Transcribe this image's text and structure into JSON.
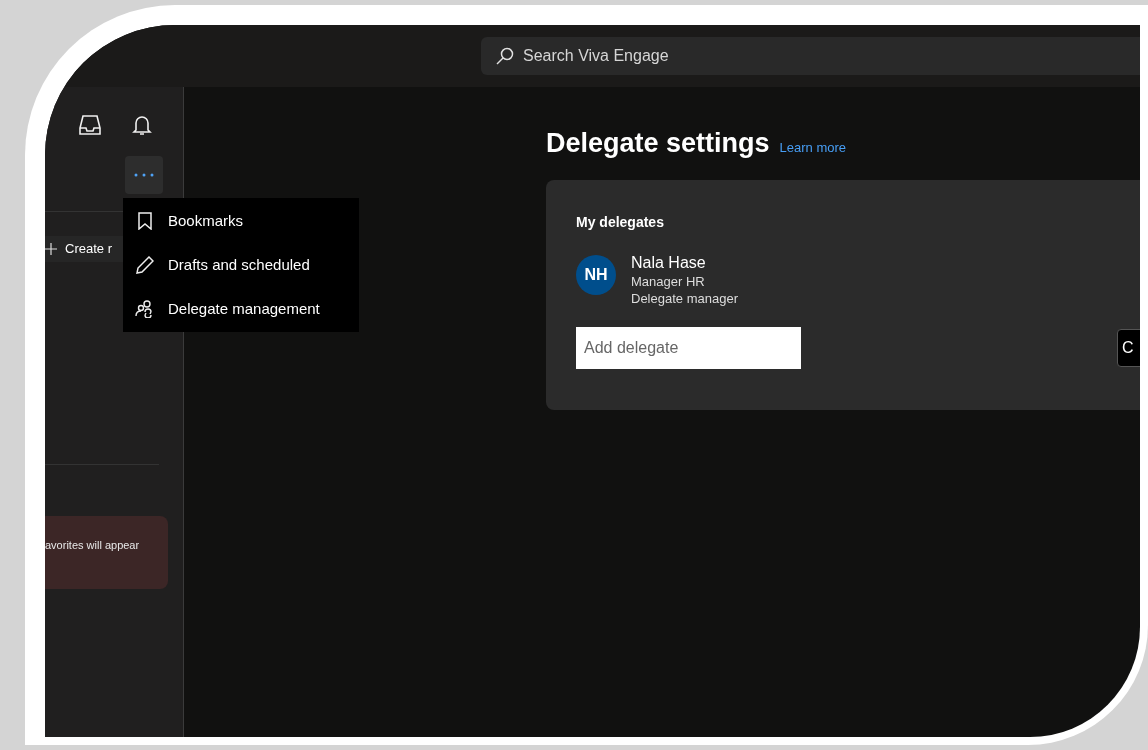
{
  "search": {
    "placeholder": "Search Viva Engage"
  },
  "sidebar": {
    "menu_open": true,
    "create_button": {
      "label": "Create r"
    },
    "favorites_notice": "avorites will appear"
  },
  "menu": {
    "items": [
      {
        "label": "Bookmarks",
        "kind": "bookmark"
      },
      {
        "label": "Drafts and scheduled",
        "kind": "pencil"
      },
      {
        "label": "Delegate management",
        "kind": "people"
      }
    ]
  },
  "page": {
    "title": "Delegate settings",
    "learn_more": "Learn more",
    "section_title": "My delegates",
    "delegates": [
      {
        "initials": "NH",
        "name": "Nala Hase",
        "job_title": "Manager HR",
        "role": "Delegate manager"
      }
    ],
    "add_delegate": {
      "placeholder": "Add delegate"
    },
    "button": {
      "label": "C"
    }
  }
}
